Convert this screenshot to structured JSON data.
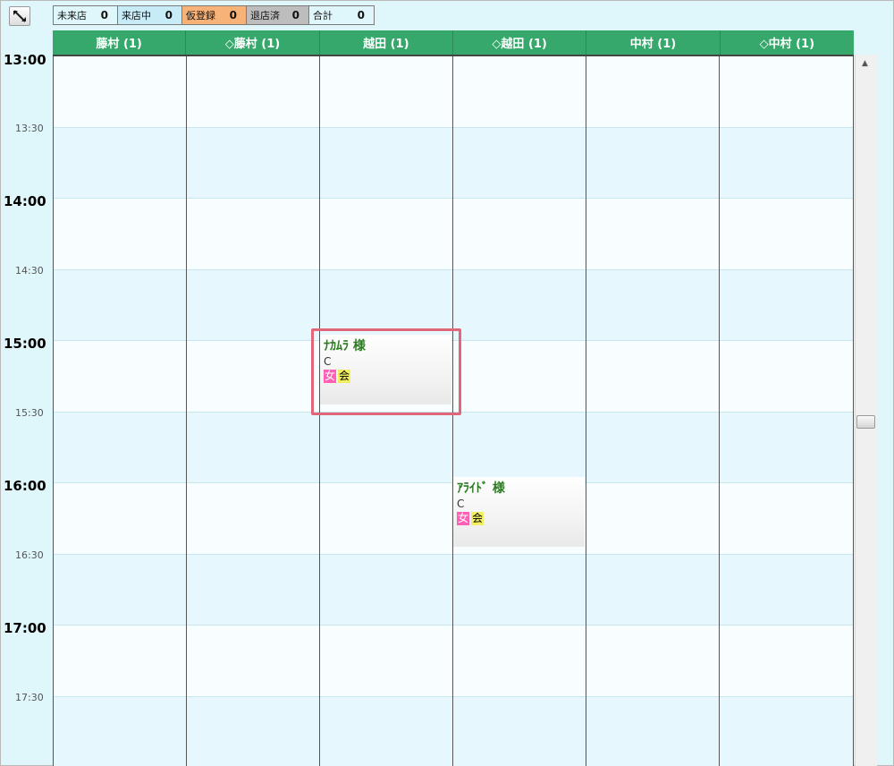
{
  "toolbar": {
    "expand_icon": "expand-arrows-icon",
    "statuses": [
      {
        "label": "未来店",
        "count": "0",
        "color": "#ffffff"
      },
      {
        "label": "来店中",
        "count": "0",
        "color": "#c7ebf7"
      },
      {
        "label": "仮登録",
        "count": "0",
        "color": "#f7b278"
      },
      {
        "label": "退店済",
        "count": "0",
        "color": "#bdbdbd"
      },
      {
        "label": "合計",
        "count": "0",
        "color": "#ffffff"
      }
    ]
  },
  "staff": [
    "藤村 (1)",
    "◇藤村 (1)",
    "越田 (1)",
    "◇越田 (1)",
    "中村 (1)",
    "◇中村 (1)"
  ],
  "times": [
    {
      "label": "13:00",
      "kind": "hour"
    },
    {
      "label": "13:30",
      "kind": "half"
    },
    {
      "label": "14:00",
      "kind": "hour"
    },
    {
      "label": "14:30",
      "kind": "half"
    },
    {
      "label": "15:00",
      "kind": "hour"
    },
    {
      "label": "15:30",
      "kind": "half"
    },
    {
      "label": "16:00",
      "kind": "hour"
    },
    {
      "label": "16:30",
      "kind": "half"
    },
    {
      "label": "17:00",
      "kind": "hour"
    },
    {
      "label": "17:30",
      "kind": "half"
    }
  ],
  "appointments": [
    {
      "name": "ﾅｶﾑﾗ 様",
      "course": "C",
      "tag_female": "女",
      "tag_member": "会",
      "staff": "越田 (1)",
      "start": "15:00",
      "end": "15:30",
      "highlighted": true
    },
    {
      "name": "ｱﾗｲﾄﾞ 様",
      "course": "C",
      "tag_female": "女",
      "tag_member": "会",
      "staff": "◇越田 (1)",
      "start": "16:00",
      "end": "16:30",
      "highlighted": false
    }
  ],
  "colors": {
    "header": "#37a86b",
    "highlight": "#e06678",
    "name_text": "#2c7a22"
  }
}
